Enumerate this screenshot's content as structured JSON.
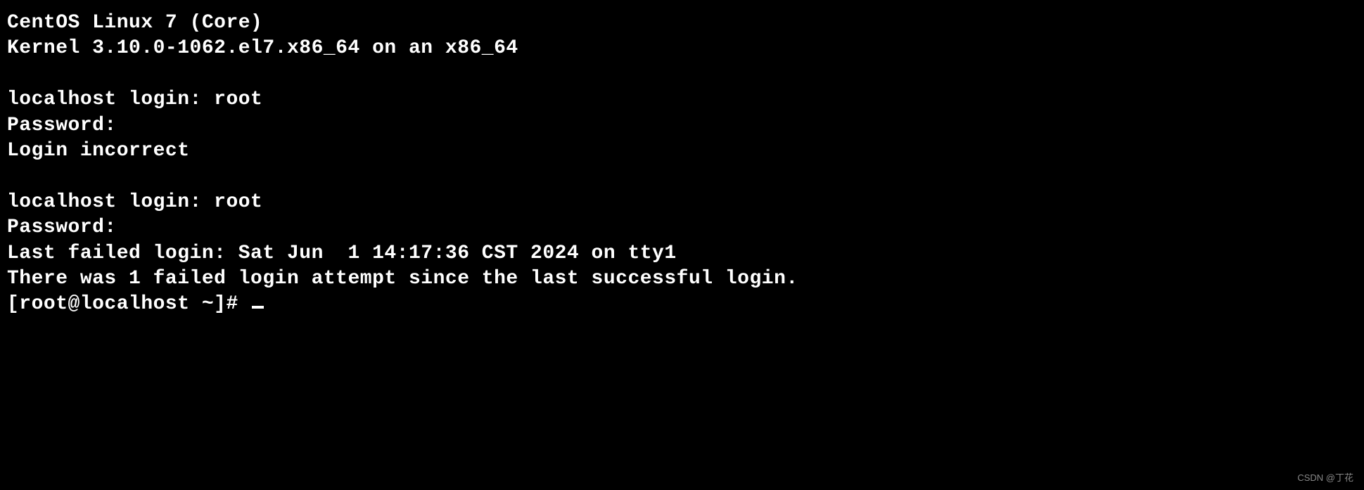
{
  "terminal": {
    "lines": [
      "CentOS Linux 7 (Core)",
      "Kernel 3.10.0-1062.el7.x86_64 on an x86_64",
      "",
      "localhost login: root",
      "Password:",
      "Login incorrect",
      "",
      "localhost login: root",
      "Password:",
      "Last failed login: Sat Jun  1 14:17:36 CST 2024 on tty1",
      "There was 1 failed login attempt since the last successful login."
    ],
    "prompt": "[root@localhost ~]# "
  },
  "watermark": "CSDN @丁花"
}
